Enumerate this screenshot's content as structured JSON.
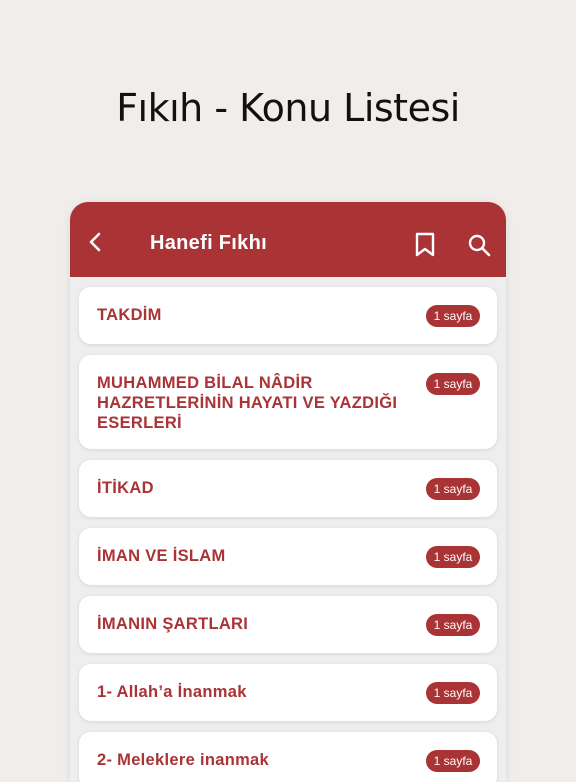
{
  "headline": "Fıkıh - Konu Listesi",
  "appbar": {
    "title": "Hanefi Fıkhı",
    "back_icon": "chevron-left-icon",
    "bookmark_icon": "bookmark-icon",
    "search_icon": "search-icon"
  },
  "colors": {
    "accent": "#a93335",
    "background": "#f0edeb",
    "card": "#ffffff"
  },
  "topics": [
    {
      "title": "TAKDİM",
      "pages": "1 sayfa"
    },
    {
      "title": "MUHAMMED BİLAL NÂDİR HAZRETLERİNİN HAYATI VE YAZDIĞI ESERLERİ",
      "pages": "1 sayfa"
    },
    {
      "title": "İTİKAD",
      "pages": "1 sayfa"
    },
    {
      "title": "İMAN VE İSLAM",
      "pages": "1 sayfa"
    },
    {
      "title": "İMANIN ŞARTLARI",
      "pages": "1 sayfa"
    },
    {
      "title": "1- Allah’a İnanmak",
      "pages": "1 sayfa"
    },
    {
      "title": "2- Meleklere inanmak",
      "pages": "1 sayfa"
    }
  ]
}
